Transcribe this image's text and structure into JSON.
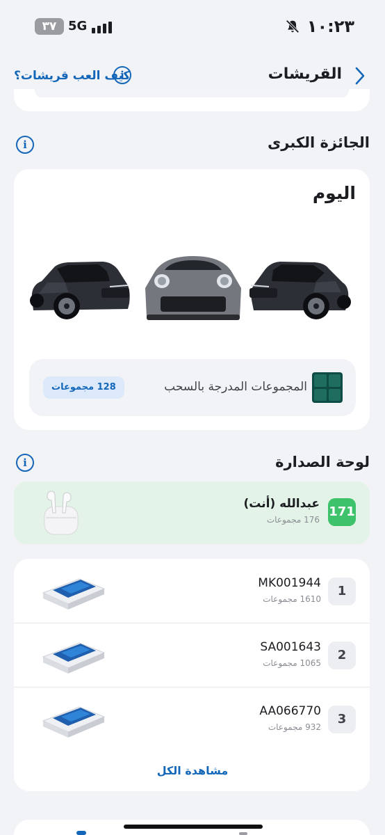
{
  "status_bar": {
    "time": "١٠:٢٣",
    "battery": "٣٧",
    "network": "5G",
    "icons": [
      "bell-slash-icon",
      "signal-icon",
      "battery-icon"
    ]
  },
  "nav": {
    "title": "القريشات",
    "help_link": "كيف العب قريشات؟",
    "back_icon": "chevron-right-icon",
    "info_icon": "info-icon"
  },
  "grand_prize": {
    "title": "الجائزة الكبرى",
    "period": "اليوم",
    "prize_images": [
      "suv-car-image",
      "sports-car-image",
      "suv-car-image"
    ],
    "pool_label": "المجموعات المدرجة بالسحب",
    "pool_badge": "128 مجموعات"
  },
  "leaderboard": {
    "title": "لوحة الصدارة",
    "me": {
      "rank": "171",
      "name": "عبدالله (أنت)",
      "count": "176 مجموعات",
      "prize": "airpods-image"
    },
    "rows": [
      {
        "rank": "1",
        "name": "MK001944",
        "count": "1610 مجموعات",
        "prize": "iphone-box-image"
      },
      {
        "rank": "2",
        "name": "SA001643",
        "count": "1065 مجموعات",
        "prize": "iphone-box-image"
      },
      {
        "rank": "3",
        "name": "AA066770",
        "count": "932 مجموعات",
        "prize": "iphone-box-image"
      }
    ],
    "view_all": "مشاهدة الكل"
  },
  "colors": {
    "accent": "#1467b8",
    "background": "#f2f3f7",
    "me_highlight": "#e3f3e8",
    "me_rank": "#3ec26b"
  }
}
